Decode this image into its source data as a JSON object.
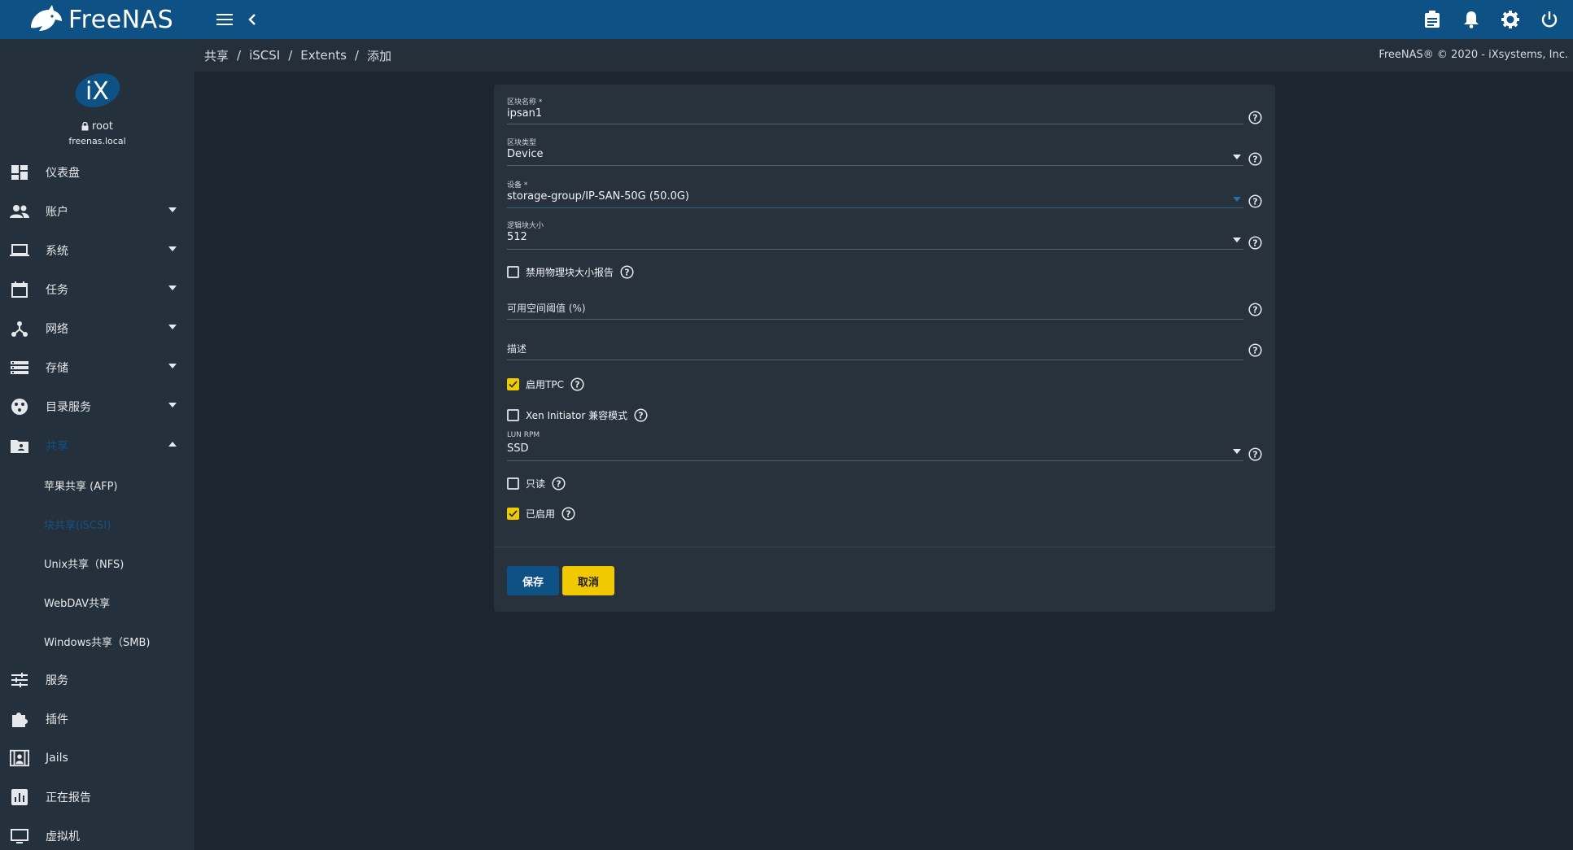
{
  "app": {
    "brand": "FreeNAS",
    "copyright": "FreeNAS® © 2020 - iXsystems, Inc."
  },
  "topbar": {
    "icons": [
      "menu-icon",
      "chevron-left-icon",
      "clipboard-icon",
      "bell-icon",
      "gear-icon",
      "power-icon"
    ]
  },
  "user": {
    "name": "root",
    "host": "freenas.local"
  },
  "nav": {
    "dashboard": "仪表盘",
    "accounts": "账户",
    "system": "系统",
    "tasks": "任务",
    "network": "网络",
    "storage": "存储",
    "directory": "目录服务",
    "sharing": "共享",
    "sub": {
      "afp": "苹果共享 (AFP)",
      "iscsi": "块共享(iSCSI)",
      "nfs": "Unix共享（NFS)",
      "webdav": "WebDAV共享",
      "smb": "Windows共享（SMB)"
    },
    "services": "服务",
    "plugins": "插件",
    "jails": "Jails",
    "reporting": "正在报告",
    "vm": "虚拟机"
  },
  "breadcrumb": {
    "c1": "共享",
    "c2": "iSCSI",
    "c3": "Extents",
    "c4": "添加"
  },
  "form": {
    "extent_name": {
      "label": "区块名称 *",
      "value": "ipsan1"
    },
    "extent_type": {
      "label": "区块类型",
      "value": "Device"
    },
    "device": {
      "label": "设备 *",
      "value": "storage-group/IP-SAN-50G (50.0G)"
    },
    "block_size": {
      "label": "逻辑块大小",
      "value": "512"
    },
    "disable_phys": {
      "label": "禁用物理块大小报告",
      "checked": false
    },
    "threshold": {
      "placeholder": "可用空间阈值 (%)"
    },
    "comment": {
      "placeholder": "描述"
    },
    "tpc": {
      "label": "启用TPC",
      "checked": true
    },
    "xen": {
      "label": "Xen Initiator 兼容模式",
      "checked": false
    },
    "rpm": {
      "label": "LUN RPM",
      "value": "SSD"
    },
    "readonly": {
      "label": "只读",
      "checked": false
    },
    "enabled": {
      "label": "已启用",
      "checked": true
    },
    "save": "保存",
    "cancel": "取消"
  },
  "colors": {
    "topbar": "#0e5285",
    "sidebar": "#24303b",
    "background": "#1c2530",
    "card": "#28323d",
    "accent_yellow": "#f0c900"
  }
}
